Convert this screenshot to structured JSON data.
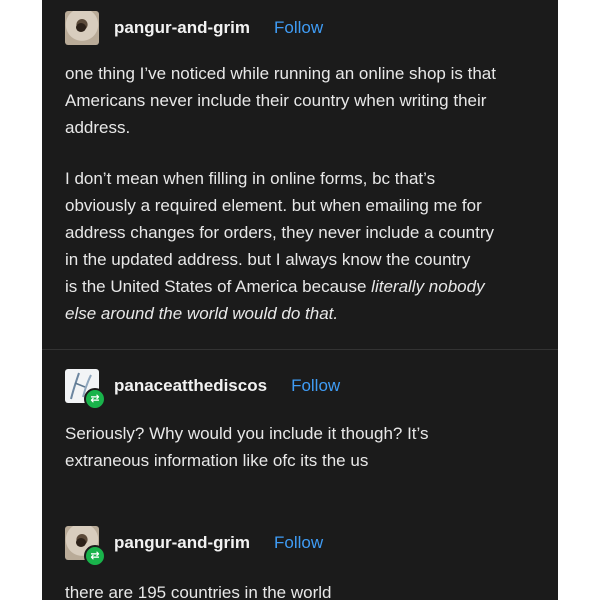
{
  "posts": [
    {
      "username": "pangur-and-grim",
      "follow": "Follow",
      "paragraphs": [
        [
          "one thing I’ve noticed while running an online shop is that",
          "Americans never include their country when writing their",
          "address."
        ],
        [
          "I don’t mean when filling in online forms, bc that’s",
          "obviously a required element. but when emailing me for",
          "address changes for orders, they never include a country",
          "in the updated address. but I always know the country"
        ]
      ],
      "line_pre_italic": "is the United States of America because ",
      "italic_1": "literally nobody",
      "italic_2": "else around the world would do that."
    },
    {
      "username": "panaceatthediscos",
      "follow": "Follow",
      "lines": [
        "Seriously? Why would you include it though? It’s",
        "extraneous information like ofc its the us"
      ]
    },
    {
      "username": "pangur-and-grim",
      "follow": "Follow",
      "lines": [
        "there are 195 countries in the world"
      ]
    }
  ],
  "icons": {
    "reblog": "reblog-icon",
    "reblog_glyph": "⇄"
  },
  "colors": {
    "background": "#1b1b1b",
    "follow": "#3f9cf5",
    "reblog_badge": "#19b34b"
  }
}
